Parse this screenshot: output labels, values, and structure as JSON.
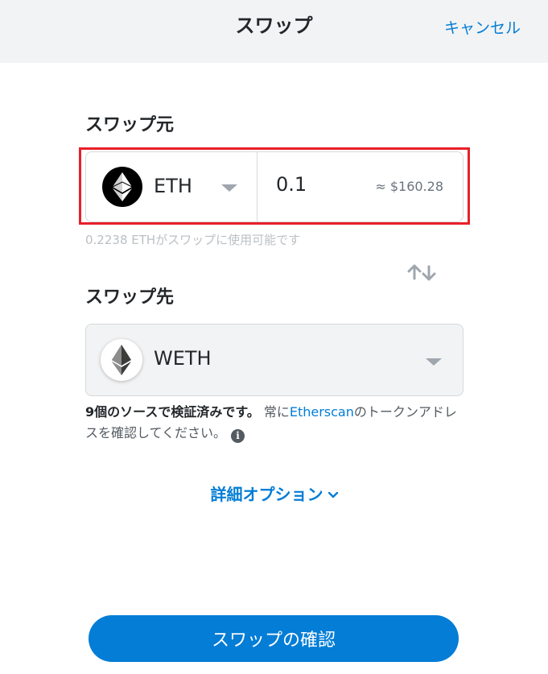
{
  "header": {
    "title": "スワップ",
    "cancel_label": "キャンセル"
  },
  "from": {
    "label": "スワップ元",
    "token_symbol": "ETH",
    "token_icon": "ethereum-icon",
    "amount": "0.1",
    "fiat_value": "≈ $160.28",
    "balance_text": "0.2238 ETHがスワップに使用可能です"
  },
  "switch": {
    "icon": "swap-arrows-icon"
  },
  "to": {
    "label": "スワップ先",
    "token_symbol": "WETH",
    "token_icon": "ethereum-icon"
  },
  "verification": {
    "bold_text": "9個のソースで検証済みです。",
    "text_before_link": " 常に",
    "link_text": "Etherscan",
    "text_after_link": "のトークンアドレスを確認してください。",
    "info_icon": "i"
  },
  "advanced": {
    "label": "詳細オプション"
  },
  "confirm": {
    "label": "スワップの確認"
  },
  "colors": {
    "accent": "#037dd6",
    "highlight_border": "#e8202a",
    "header_bg": "#f2f3f4"
  }
}
